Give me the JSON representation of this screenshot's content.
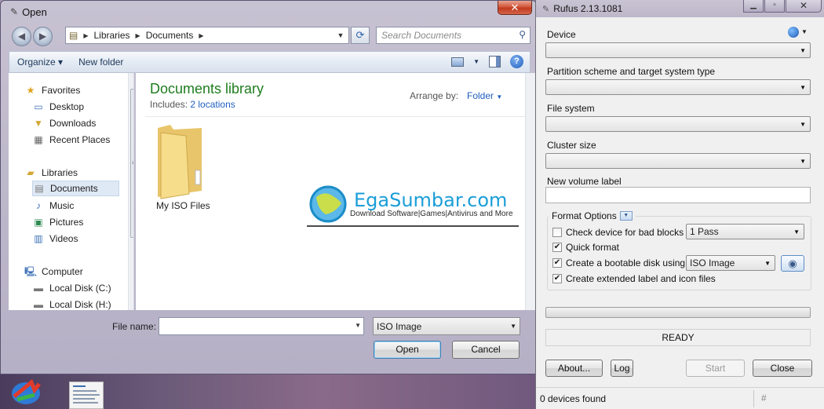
{
  "open_dialog": {
    "title": "Open",
    "close_label": "✕",
    "address": {
      "segments": [
        "Libraries",
        "Documents"
      ]
    },
    "search": {
      "placeholder": "Search Documents"
    },
    "toolbar": {
      "organize": "Organize ▾",
      "new_folder": "New folder"
    },
    "nav": {
      "items": [
        {
          "label": "Favorites",
          "icon": "star-icon"
        },
        {
          "label": "Desktop",
          "icon": "desktop-icon"
        },
        {
          "label": "Downloads",
          "icon": "downloads-icon"
        },
        {
          "label": "Recent Places",
          "icon": "recent-places-icon"
        },
        {
          "label": "Libraries",
          "icon": "libraries-icon"
        },
        {
          "label": "Documents",
          "icon": "documents-icon"
        },
        {
          "label": "Music",
          "icon": "music-icon"
        },
        {
          "label": "Pictures",
          "icon": "pictures-icon"
        },
        {
          "label": "Videos",
          "icon": "videos-icon"
        },
        {
          "label": "Computer",
          "icon": "computer-icon"
        },
        {
          "label": "Local Disk (C:)",
          "icon": "disk-icon"
        },
        {
          "label": "Local Disk (H:)",
          "icon": "disk-icon"
        }
      ]
    },
    "library": {
      "title": "Documents library",
      "includes_label": "Includes:",
      "includes_link": "2 locations",
      "arrange_label": "Arrange by:",
      "arrange_value": "Folder"
    },
    "folder": {
      "label": "My ISO Files"
    },
    "watermark": {
      "title": "EgaSumbar.com",
      "subtitle": "Download Software|Games|Antivirus and More"
    },
    "footer": {
      "file_name_label": "File name:",
      "file_name_value": "",
      "file_type": "ISO Image",
      "open_button": "Open",
      "cancel_button": "Cancel"
    }
  },
  "rufus": {
    "title": "Rufus 2.13.1081",
    "device_label": "Device",
    "partition_label": "Partition scheme and target system type",
    "filesystem_label": "File system",
    "cluster_label": "Cluster size",
    "volume_label": "New volume label",
    "volume_value": "",
    "format_options_label": "Format Options",
    "check_bad_blocks": {
      "label": "Check device for bad blocks",
      "checked": false,
      "passes": "1 Pass"
    },
    "quick_format": {
      "label": "Quick format",
      "checked": true
    },
    "bootable": {
      "label": "Create a bootable disk using",
      "checked": true,
      "source": "ISO Image"
    },
    "extended_label": {
      "label": "Create extended label and icon files",
      "checked": true
    },
    "status": "READY",
    "buttons": {
      "about": "About...",
      "log": "Log",
      "start": "Start",
      "close": "Close"
    },
    "statusbar": {
      "text": "0 devices found",
      "hash": "#"
    }
  }
}
